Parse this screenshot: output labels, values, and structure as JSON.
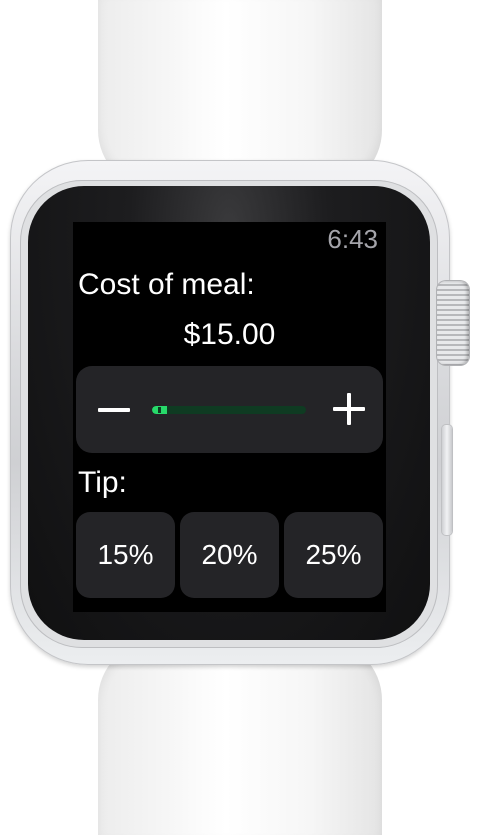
{
  "status": {
    "time": "6:43"
  },
  "meal": {
    "label": "Cost of meal:",
    "value": "$15.00",
    "slider": {
      "level_fraction": 0.1,
      "accent": "#27d96a",
      "track": "#0f3b22",
      "decrease_icon": "minus-icon",
      "increase_icon": "plus-icon"
    }
  },
  "tip": {
    "label": "Tip:",
    "options": [
      "15%",
      "20%",
      "25%"
    ]
  }
}
